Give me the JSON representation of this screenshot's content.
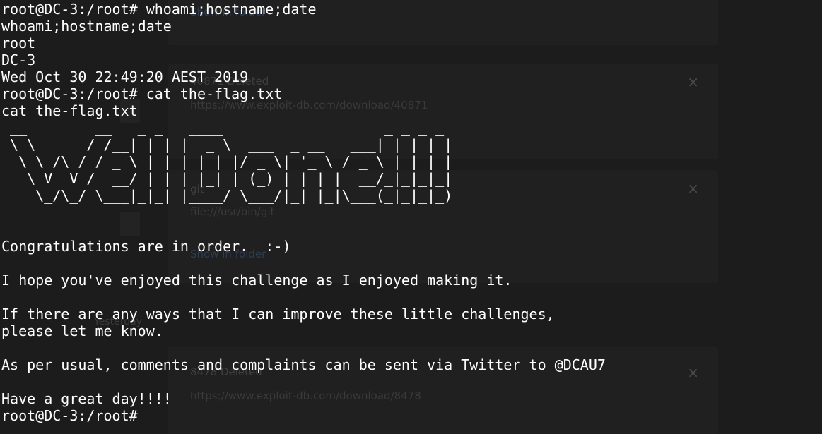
{
  "background_window": {
    "cards": [
      {
        "name": "",
        "url": "",
        "action": "Show in folder",
        "close_icon": "×"
      },
      {
        "name": "40871 Deleted",
        "url": "https://www.exploit-db.com/download/40871",
        "action": "",
        "close_icon": "×"
      },
      {
        "name": "git",
        "url": "file:///usr/bin/git",
        "action": "Show in folder",
        "close_icon": "×"
      },
      {
        "name": "8478 Deleted",
        "url": "https://www.exploit-db.com/download/8478",
        "action": "",
        "close_icon": "×"
      }
    ],
    "date_group_label": "Yesterday"
  },
  "terminal": {
    "lines": [
      "root@DC-3:/root# whoami;hostname;date",
      "whoami;hostname;date",
      "root",
      "DC-3",
      "Wed Oct 30 22:49:20 AEST 2019",
      "root@DC-3:/root# cat the-flag.txt",
      "cat the-flag.txt",
      " __        __   _ _   ____                   _ _ _ _ ",
      " \\ \\      / /__| | | |  _ \\  ___  _ __   ___| | | | |",
      "  \\ \\ /\\ / / _ \\ | | | | | |/ _ \\| '_ \\ / _ \\ | | | |",
      "   \\ V  V /  __/ | | | |_| | (_) | | | |  __/_|_|_|_|",
      "    \\_/\\_/ \\___|_|_| |____/ \\___/|_| |_|\\___(_|_|_|_)",
      "",
      "",
      "Congratulations are in order.  :-)",
      "",
      "I hope you've enjoyed this challenge as I enjoyed making it.",
      "",
      "If there are any ways that I can improve these little challenges,",
      "please let me know.",
      "",
      "As per usual, comments and complaints can be sent via Twitter to @DCAU7",
      "",
      "Have a great day!!!!",
      "root@DC-3:/root# "
    ]
  }
}
